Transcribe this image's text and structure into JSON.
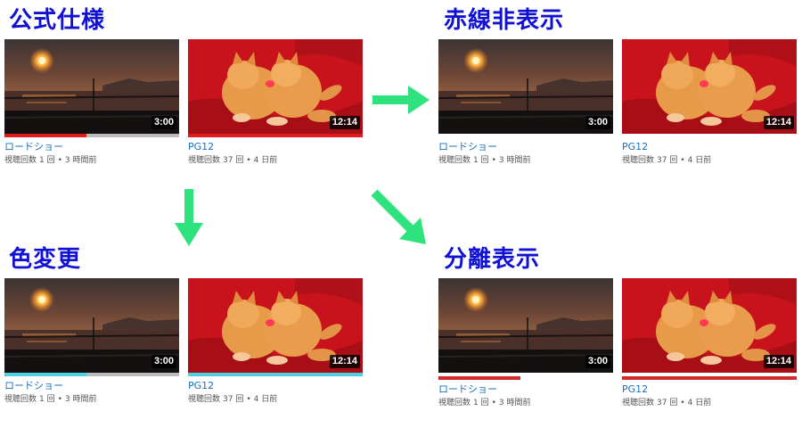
{
  "sections": [
    {
      "title": "公式仕様",
      "variant": "official",
      "colors": {
        "fill": "#e01b1b",
        "track": "#bbbbbb",
        "fill_only_bar": "#e01b1b"
      },
      "cards": [
        {
          "title": "ロードショー",
          "views_label": "視聴回数",
          "views": "1 回",
          "separator": "•",
          "time": "3 時間前",
          "duration": "3:00",
          "progress": 0.47,
          "thumbnail": "sunset-icon"
        },
        {
          "title": "PG12",
          "views_label": "視聴回数",
          "views": "37 回",
          "separator": "•",
          "time": "4 日前",
          "duration": "12:14",
          "progress": 1.0,
          "thumbnail": "kittens-icon"
        }
      ]
    },
    {
      "title": "赤線非表示",
      "variant": "hidden",
      "colors": {},
      "cards": [
        {
          "title": "ロードショー",
          "views_label": "視聴回数",
          "views": "1 回",
          "separator": "•",
          "time": "3 時間前",
          "duration": "3:00",
          "progress": null,
          "thumbnail": "sunset-icon"
        },
        {
          "title": "PG12",
          "views_label": "視聴回数",
          "views": "37 回",
          "separator": "•",
          "time": "4 日前",
          "duration": "12:14",
          "progress": null,
          "thumbnail": "kittens-icon"
        }
      ]
    },
    {
      "title": "色変更",
      "variant": "recolor",
      "colors": {
        "fill": "#4fd0e0",
        "track": "#bbbbbb"
      },
      "cards": [
        {
          "title": "ロードショー",
          "views_label": "視聴回数",
          "views": "1 回",
          "separator": "•",
          "time": "3 時間前",
          "duration": "3:00",
          "progress": 0.47,
          "thumbnail": "sunset-icon"
        },
        {
          "title": "PG12",
          "views_label": "視聴回数",
          "views": "37 回",
          "separator": "•",
          "time": "4 日前",
          "duration": "12:14",
          "progress": 1.0,
          "thumbnail": "kittens-icon"
        }
      ]
    },
    {
      "title": "分離表示",
      "variant": "separated",
      "colors": {
        "fill": "#d42a2a",
        "track": "#ffffff"
      },
      "cards": [
        {
          "title": "ロードショー",
          "views_label": "視聴回数",
          "views": "1 回",
          "separator": "•",
          "time": "3 時間前",
          "duration": "3:00",
          "progress": 0.47,
          "thumbnail": "sunset-icon"
        },
        {
          "title": "PG12",
          "views_label": "視聴回数",
          "views": "37 回",
          "separator": "•",
          "time": "4 日前",
          "duration": "12:14",
          "progress": 1.0,
          "thumbnail": "kittens-icon"
        }
      ]
    }
  ],
  "arrows": [
    {
      "name": "arrow-right-icon",
      "color": "#2ee37e"
    },
    {
      "name": "arrow-down-icon",
      "color": "#2ee37e"
    },
    {
      "name": "arrow-diagonal-icon",
      "color": "#2ee37e"
    }
  ]
}
